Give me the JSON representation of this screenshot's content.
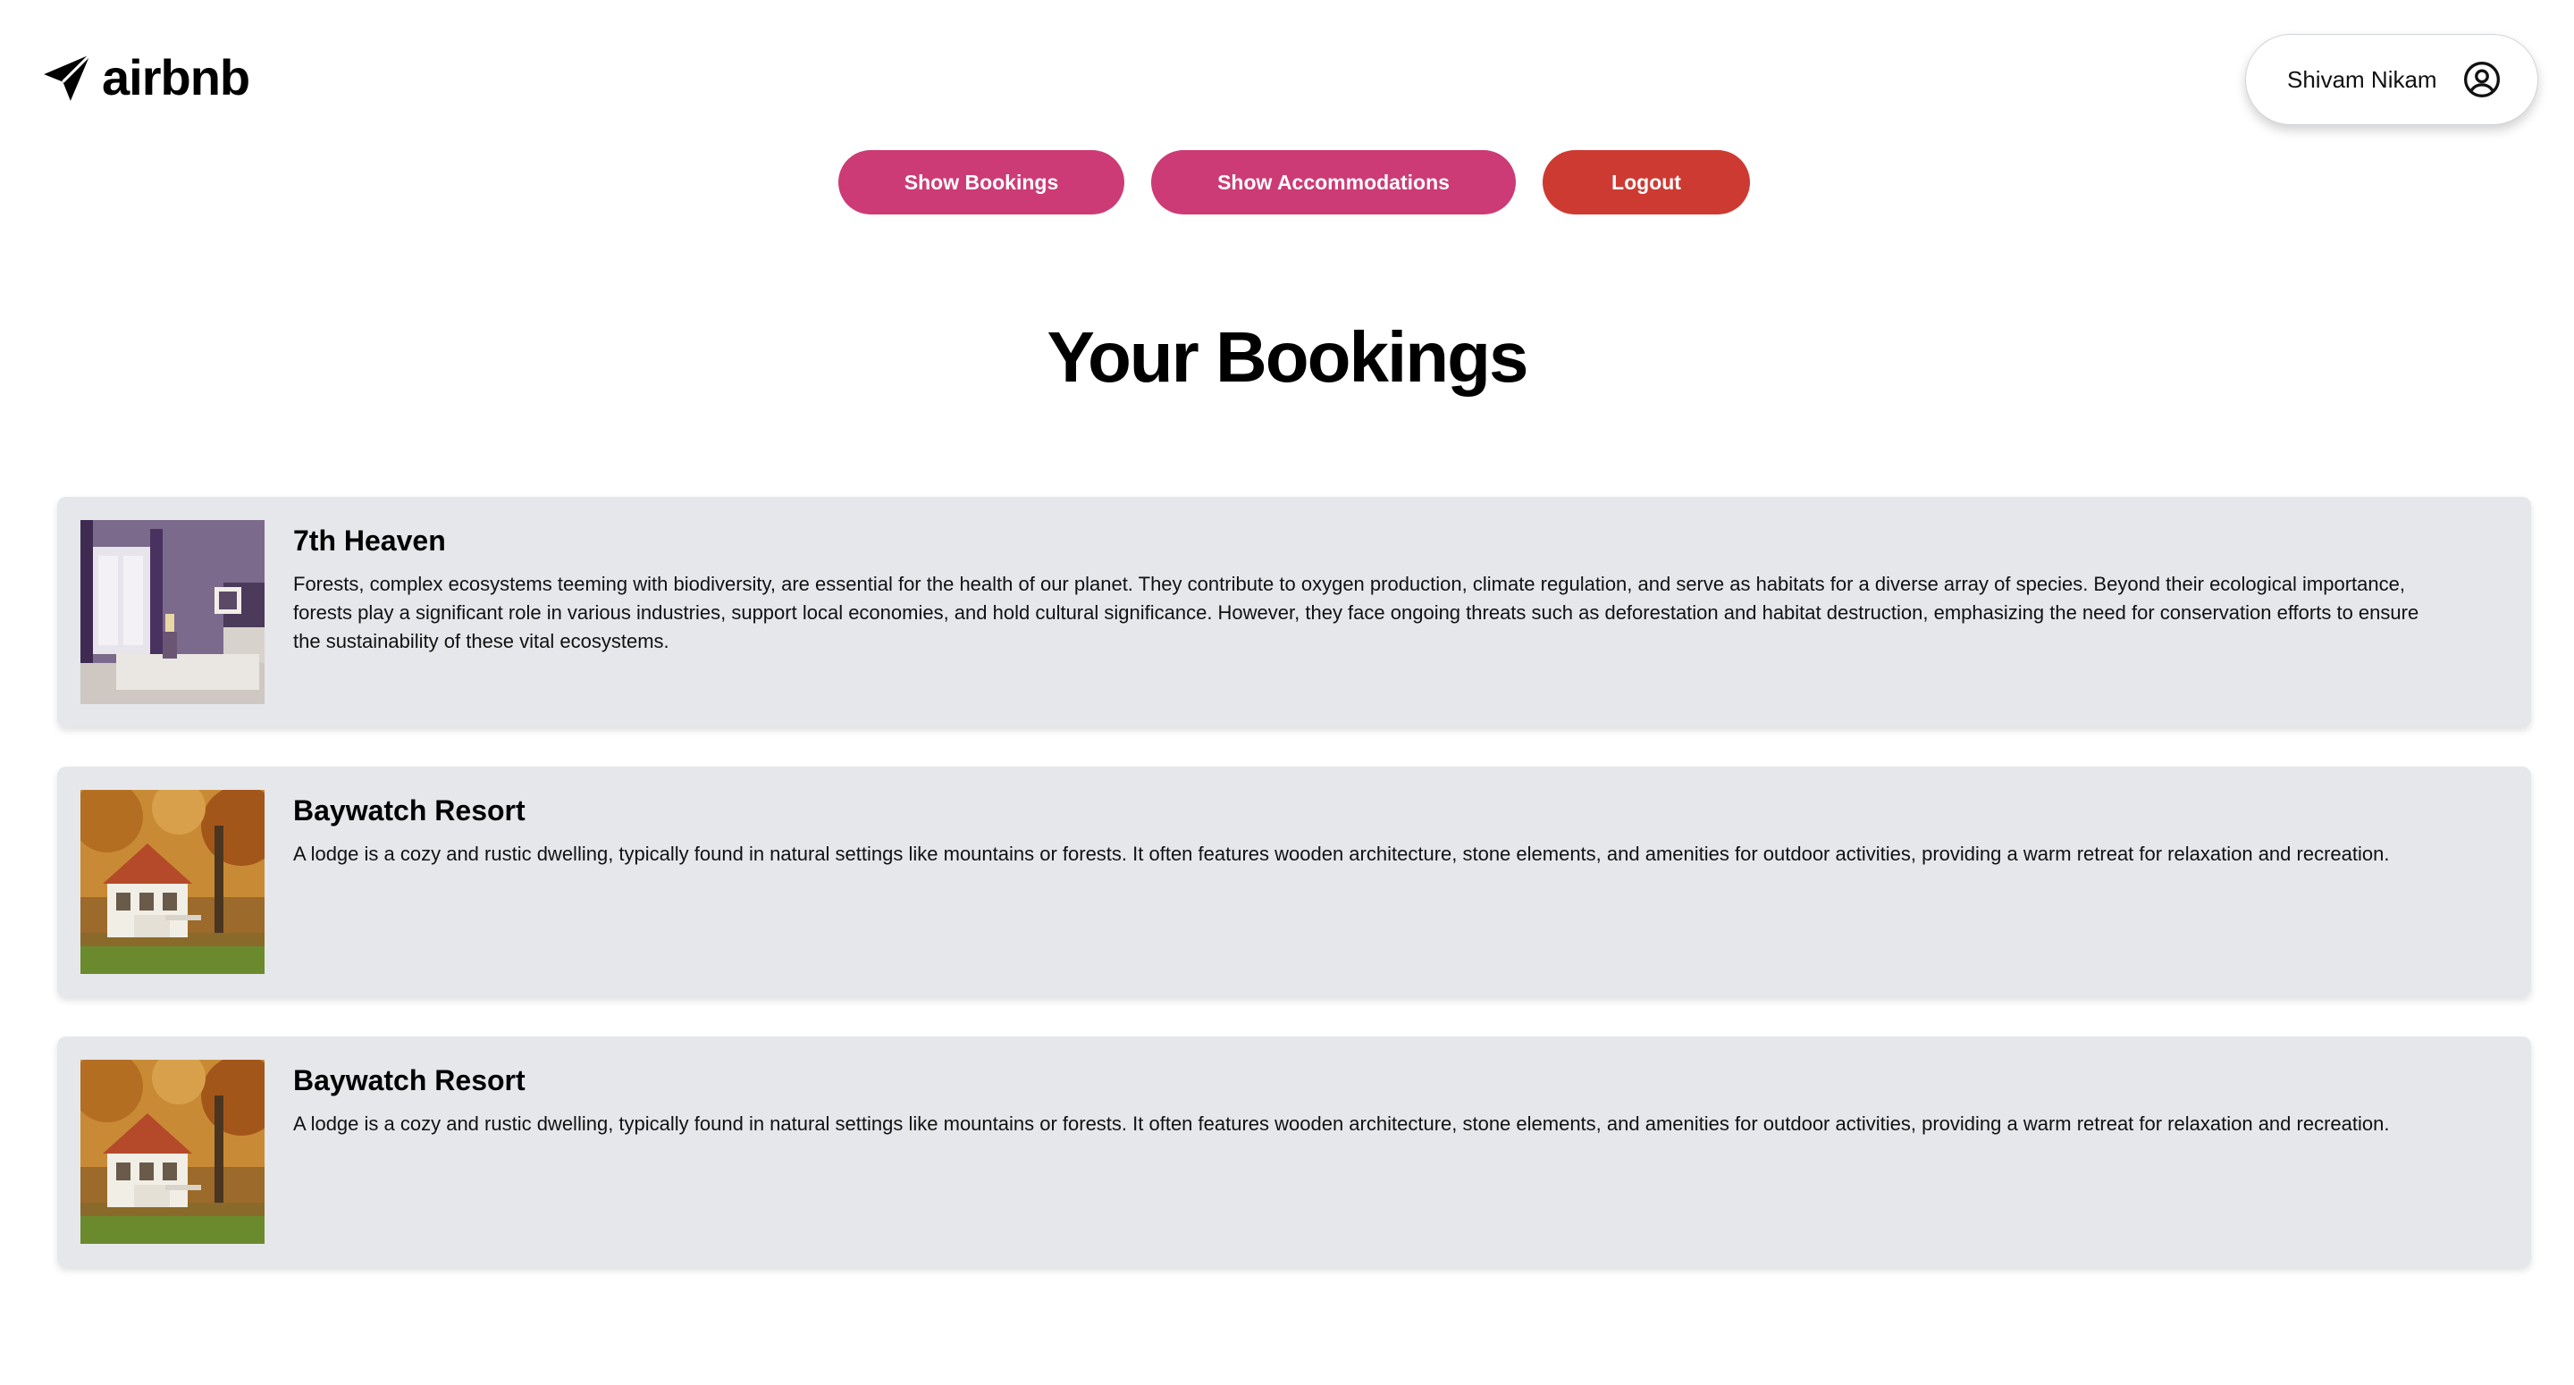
{
  "header": {
    "logo_text": "airbnb",
    "user_name": "Shivam Nikam"
  },
  "nav": {
    "show_bookings": "Show Bookings",
    "show_accommodations": "Show Accommodations",
    "logout": "Logout"
  },
  "page_title": "Your Bookings",
  "colors": {
    "primary": "#cc3b76",
    "logout": "#cd3a32",
    "card_bg": "#e5e7eb"
  },
  "bookings": [
    {
      "title": "7th Heaven",
      "description": "Forests, complex ecosystems teeming with biodiversity, are essential for the health of our planet. They contribute to oxygen production, climate regulation, and serve as habitats for a diverse array of species. Beyond their ecological importance, forests play a significant role in various industries, support local economies, and hold cultural significance. However, they face ongoing threats such as deforestation and habitat destruction, emphasizing the need for conservation efforts to ensure the sustainability of these vital ecosystems.",
      "image": "bedroom-photo"
    },
    {
      "title": "Baywatch Resort",
      "description": "A lodge is a cozy and rustic dwelling, typically found in natural settings like mountains or forests. It often features wooden architecture, stone elements, and amenities for outdoor activities, providing a warm retreat for relaxation and recreation.",
      "image": "lodge-photo"
    },
    {
      "title": "Baywatch Resort",
      "description": "A lodge is a cozy and rustic dwelling, typically found in natural settings like mountains or forests. It often features wooden architecture, stone elements, and amenities for outdoor activities, providing a warm retreat for relaxation and recreation.",
      "image": "lodge-photo"
    }
  ]
}
